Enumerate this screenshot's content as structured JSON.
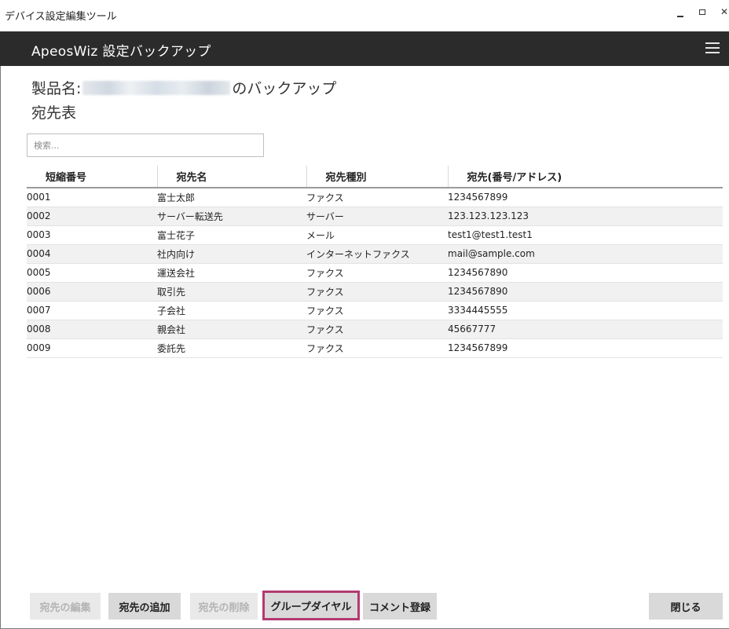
{
  "window": {
    "title": "デバイス設定編集ツール",
    "controls": {
      "minimize": "minimize-icon",
      "maximize": "maximize-icon",
      "close": "✕"
    }
  },
  "header": {
    "app_title": "ApeosWiz 設定バックアップ",
    "menu_icon": "hamburger-menu-icon"
  },
  "product": {
    "prefix": "製品名:",
    "suffix": "のバックアップ"
  },
  "section_title": "宛先表",
  "search": {
    "placeholder": "検索..."
  },
  "table": {
    "columns": [
      "短縮番号",
      "宛先名",
      "宛先種別",
      "宛先(番号/アドレス)"
    ],
    "rows": [
      [
        "0001",
        "富士太郎",
        "ファクス",
        "1234567899"
      ],
      [
        "0002",
        "サーバー転送先",
        "サーバー",
        "123.123.123.123"
      ],
      [
        "0003",
        "富士花子",
        "メール",
        "test1@test1.test1"
      ],
      [
        "0004",
        "社内向け",
        "インターネットファクス",
        "mail@sample.com"
      ],
      [
        "0005",
        "運送会社",
        "ファクス",
        "1234567890"
      ],
      [
        "0006",
        "取引先",
        "ファクス",
        "1234567890"
      ],
      [
        "0007",
        "子会社",
        "ファクス",
        "3334445555"
      ],
      [
        "0008",
        "親会社",
        "ファクス",
        "45667777"
      ],
      [
        "0009",
        "委託先",
        "ファクス",
        "1234567899"
      ]
    ]
  },
  "buttons": {
    "edit": "宛先の編集",
    "add": "宛先の追加",
    "delete": "宛先の削除",
    "group_dial": "グループダイヤル",
    "comment": "コメント登録",
    "close": "閉じる"
  },
  "colors": {
    "header_bg": "#2b2b2b",
    "highlight_border": "#b23a70"
  }
}
